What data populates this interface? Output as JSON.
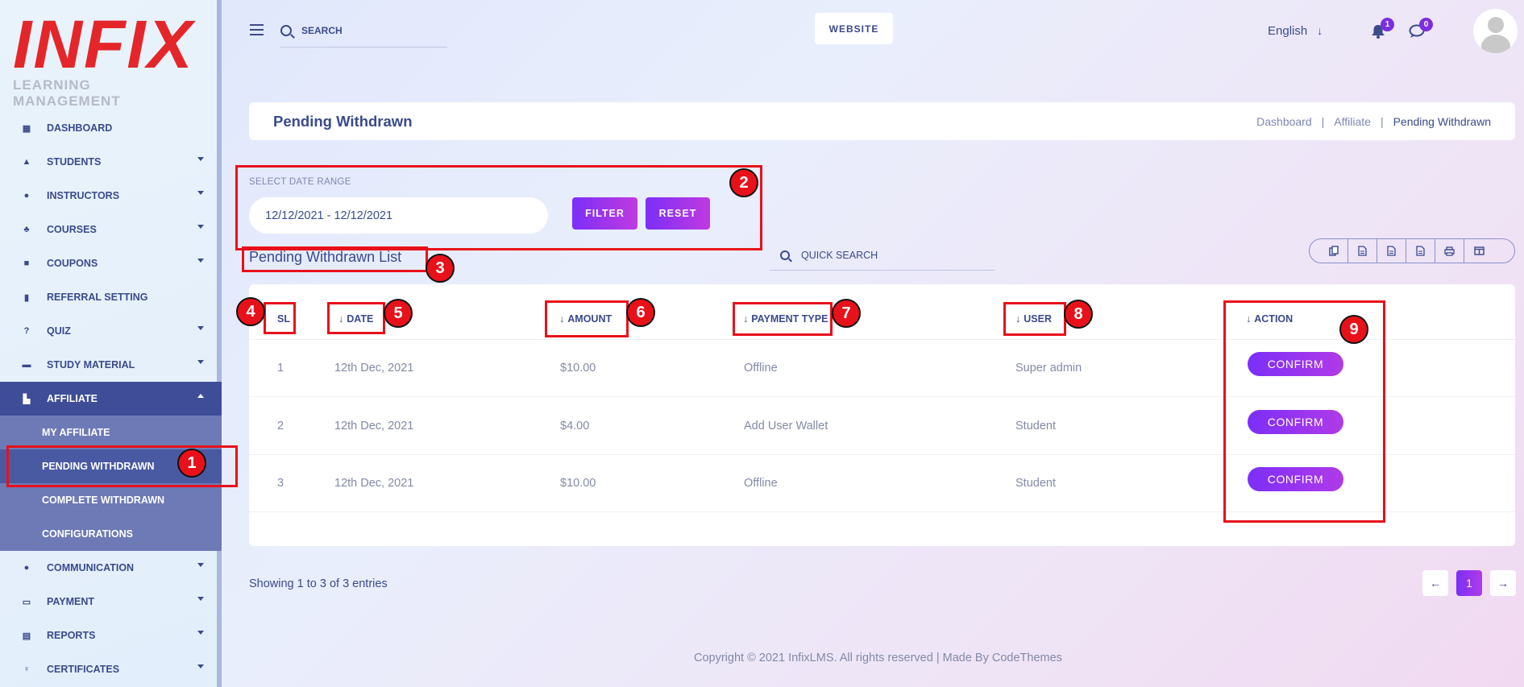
{
  "sidebar": {
    "logo": "INFIX",
    "logo_sub": "LEARNING MANAGEMENT",
    "items": [
      {
        "label": "DASHBOARD",
        "icon": "grid-icon"
      },
      {
        "label": "STUDENTS",
        "icon": "graduation-cap-icon"
      },
      {
        "label": "INSTRUCTORS",
        "icon": "users-icon"
      },
      {
        "label": "COURSES",
        "icon": "shapes-icon"
      },
      {
        "label": "COUPONS",
        "icon": "gift-icon"
      },
      {
        "label": "REFERRAL SETTING",
        "icon": "building-icon"
      },
      {
        "label": "QUIZ",
        "icon": "question-circle-icon"
      },
      {
        "label": "STUDY MATERIAL",
        "icon": "book-icon"
      },
      {
        "label": "AFFILIATE",
        "icon": "chart-icon"
      },
      {
        "label": "COMMUNICATION",
        "icon": "chat-icon"
      },
      {
        "label": "PAYMENT",
        "icon": "money-icon"
      },
      {
        "label": "REPORTS",
        "icon": "calculator-icon"
      },
      {
        "label": "CERTIFICATES",
        "icon": "certificate-icon"
      }
    ],
    "affiliate_sub": [
      "MY AFFILIATE",
      "PENDING WITHDRAWN",
      "COMPLETE WITHDRAWN",
      "CONFIGURATIONS"
    ]
  },
  "topbar": {
    "search_placeholder": "SEARCH",
    "website": "WEBSITE",
    "language": "English",
    "notifications": "1",
    "messages": "0"
  },
  "page": {
    "title": "Pending Withdrawn",
    "breadcrumb": [
      "Dashboard",
      "Affiliate",
      "Pending Withdrawn"
    ],
    "breadcrumb_sep": "|"
  },
  "filter": {
    "label": "SELECT DATE RANGE",
    "date_range": "12/12/2021 - 12/12/2021",
    "filter_btn": "FILTER",
    "reset_btn": "RESET"
  },
  "list": {
    "title": "Pending Withdrawn List",
    "quick_search_placeholder": "QUICK SEARCH",
    "headers": [
      "SL",
      "DATE",
      "AMOUNT",
      "PAYMENT TYPE",
      "USER",
      "ACTION"
    ],
    "rows": [
      {
        "sl": "1",
        "date": "12th Dec, 2021",
        "amount": "$10.00",
        "payment_type": "Offline",
        "user": "Super admin",
        "action": "CONFIRM"
      },
      {
        "sl": "2",
        "date": "12th Dec, 2021",
        "amount": "$4.00",
        "payment_type": "Add User Wallet",
        "user": "Student",
        "action": "CONFIRM"
      },
      {
        "sl": "3",
        "date": "12th Dec, 2021",
        "amount": "$10.00",
        "payment_type": "Offline",
        "user": "Student",
        "action": "CONFIRM"
      }
    ],
    "showing": "Showing 1 to 3 of 3 entries",
    "page": "1"
  },
  "footer": "Copyright © 2021 InfixLMS. All rights reserved | Made By CodeThemes",
  "annotations": [
    "1",
    "2",
    "3",
    "4",
    "5",
    "6",
    "7",
    "8",
    "9"
  ],
  "colors": {
    "accent": "#7b2ff7",
    "sidebar_active": "#3f4d98",
    "annotation": "#e8111a"
  }
}
